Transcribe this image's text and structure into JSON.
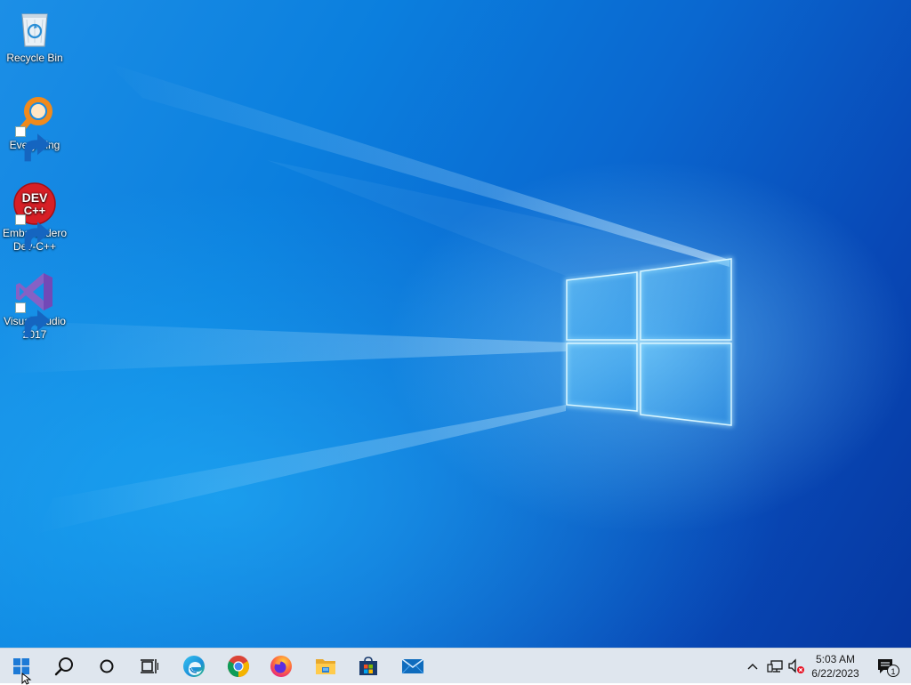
{
  "desktop": {
    "icons": [
      {
        "label": "Recycle Bin",
        "icon": "recycle-bin-icon",
        "shortcut": false
      },
      {
        "label": "Everything",
        "icon": "everything-search-icon",
        "shortcut": true
      },
      {
        "label": "Embarcadero Dev-C++",
        "icon": "devcpp-icon",
        "shortcut": true,
        "icon_text_1": "DEV",
        "icon_text_2": "C++"
      },
      {
        "label": "Visual Studio 2017",
        "icon": "visual-studio-icon",
        "shortcut": true
      }
    ],
    "wallpaper": "windows-10-hero-wallpaper"
  },
  "taskbar": {
    "buttons": [
      {
        "name": "start",
        "icon": "windows-start-icon"
      },
      {
        "name": "search",
        "icon": "search-icon"
      },
      {
        "name": "cortana",
        "icon": "cortana-circle-icon"
      },
      {
        "name": "task-view",
        "icon": "task-view-icon"
      },
      {
        "name": "edge",
        "icon": "edge-icon"
      },
      {
        "name": "chrome",
        "icon": "chrome-icon"
      },
      {
        "name": "firefox",
        "icon": "firefox-icon"
      },
      {
        "name": "file-explorer",
        "icon": "folder-icon"
      },
      {
        "name": "microsoft-store",
        "icon": "store-icon"
      },
      {
        "name": "mail",
        "icon": "mail-icon"
      }
    ],
    "tray": {
      "show_hidden": "chevron-up-icon",
      "network": "network-icon",
      "volume": "volume-muted-icon",
      "notifications": "action-center-icon",
      "notification_count": "1"
    },
    "clock": {
      "time": "5:03 AM",
      "date": "6/22/2023"
    }
  },
  "colors": {
    "taskbar_bg": "#dfe6ee",
    "wallpaper_light": "#1c8fe6",
    "wallpaper_dark": "#0637a0"
  }
}
